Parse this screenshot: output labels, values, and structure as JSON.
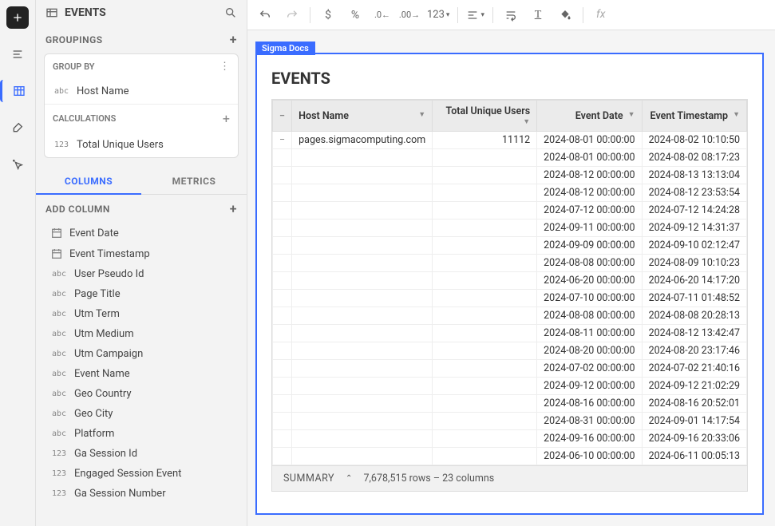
{
  "panel": {
    "title": "EVENTS",
    "groupings_label": "GROUPINGS",
    "group_by_label": "GROUP BY",
    "group_by_field": "Host Name",
    "calculations_label": "CALCULATIONS",
    "calc_field": "Total Unique Users",
    "tab_columns": "COLUMNS",
    "tab_metrics": "METRICS",
    "add_column_label": "ADD COLUMN",
    "columns": [
      {
        "type": "date",
        "label": "Event Date"
      },
      {
        "type": "date",
        "label": "Event Timestamp"
      },
      {
        "type": "abc",
        "label": "User Pseudo Id"
      },
      {
        "type": "abc",
        "label": "Page Title"
      },
      {
        "type": "abc",
        "label": "Utm Term"
      },
      {
        "type": "abc",
        "label": "Utm Medium"
      },
      {
        "type": "abc",
        "label": "Utm Campaign"
      },
      {
        "type": "abc",
        "label": "Event Name"
      },
      {
        "type": "abc",
        "label": "Geo Country"
      },
      {
        "type": "abc",
        "label": "Geo City"
      },
      {
        "type": "abc",
        "label": "Platform"
      },
      {
        "type": "123",
        "label": "Ga Session Id"
      },
      {
        "type": "123",
        "label": "Engaged Session Event"
      },
      {
        "type": "123",
        "label": "Ga Session Number"
      }
    ]
  },
  "toolbar": {
    "num_format": "123",
    "fx": "fx"
  },
  "doc": {
    "tab_label": "Sigma Docs",
    "heading": "EVENTS",
    "headers": {
      "host": "Host Name",
      "users": "Total Unique Users",
      "date": "Event Date",
      "ts": "Event Timestamp"
    },
    "group_value": "pages.sigmacomputing.com",
    "users_value": "11112",
    "rows": [
      {
        "d": "2024-08-01 00:00:00",
        "t": "2024-08-02 10:10:50"
      },
      {
        "d": "2024-08-01 00:00:00",
        "t": "2024-08-02 08:17:23"
      },
      {
        "d": "2024-08-12 00:00:00",
        "t": "2024-08-13 13:13:04"
      },
      {
        "d": "2024-08-12 00:00:00",
        "t": "2024-08-12 23:53:54"
      },
      {
        "d": "2024-07-12 00:00:00",
        "t": "2024-07-12 14:24:28"
      },
      {
        "d": "2024-09-11 00:00:00",
        "t": "2024-09-12 14:31:37"
      },
      {
        "d": "2024-09-09 00:00:00",
        "t": "2024-09-10 02:12:47"
      },
      {
        "d": "2024-08-08 00:00:00",
        "t": "2024-08-09 10:10:23"
      },
      {
        "d": "2024-06-20 00:00:00",
        "t": "2024-06-20 14:17:20"
      },
      {
        "d": "2024-07-10 00:00:00",
        "t": "2024-07-11 01:48:52"
      },
      {
        "d": "2024-08-08 00:00:00",
        "t": "2024-08-08 20:28:13"
      },
      {
        "d": "2024-08-11 00:00:00",
        "t": "2024-08-12 13:42:47"
      },
      {
        "d": "2024-08-20 00:00:00",
        "t": "2024-08-20 23:17:46"
      },
      {
        "d": "2024-07-02 00:00:00",
        "t": "2024-07-02 21:40:16"
      },
      {
        "d": "2024-09-12 00:00:00",
        "t": "2024-09-12 21:02:29"
      },
      {
        "d": "2024-08-16 00:00:00",
        "t": "2024-08-16 20:52:01"
      },
      {
        "d": "2024-08-31 00:00:00",
        "t": "2024-09-01 14:17:54"
      },
      {
        "d": "2024-09-16 00:00:00",
        "t": "2024-09-16 20:33:06"
      },
      {
        "d": "2024-06-10 00:00:00",
        "t": "2024-06-11 00:05:13"
      }
    ],
    "summary_label": "SUMMARY",
    "summary_text": "7,678,515 rows – 23 columns"
  }
}
